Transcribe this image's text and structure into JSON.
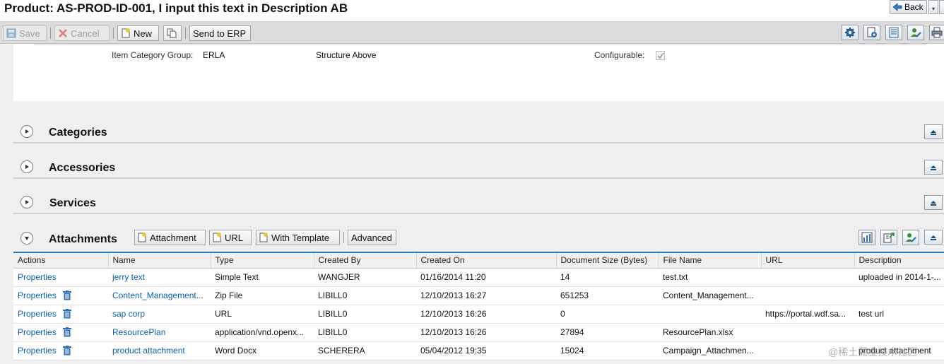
{
  "header": {
    "title": "Product: AS-PROD-ID-001, I input this text in Description AB",
    "back_label": "Back"
  },
  "toolbar": {
    "save_label": "Save",
    "cancel_label": "Cancel",
    "new_label": "New",
    "send_label": "Send to ERP"
  },
  "general": {
    "item_category_group_label": "Item Category Group:",
    "item_category_group_value": "ERLA",
    "structure_label": "Structure Above",
    "configurable_label": "Configurable:"
  },
  "sections": {
    "categories": "Categories",
    "accessories": "Accessories",
    "services": "Services",
    "attachments": "Attachments"
  },
  "attachments_toolbar": {
    "attachment_label": "Attachment",
    "url_label": "URL",
    "with_template_label": "With Template",
    "advanced_label": "Advanced"
  },
  "table": {
    "columns": [
      "Actions",
      "Name",
      "Type",
      "Created By",
      "Created On",
      "Document Size (Bytes)",
      "File Name",
      "URL",
      "Description"
    ],
    "rows": [
      {
        "action": "Properties",
        "name": "jerry text",
        "type": "Simple Text",
        "created_by": "WANGJER",
        "created_on": "01/16/2014 11:20",
        "size": "14",
        "file_name": "test.txt",
        "url": "",
        "description": "uploaded in 2014-1-..."
      },
      {
        "action": "Properties",
        "name": "Content_Management...",
        "type": "Zip File",
        "created_by": "LIBILL0",
        "created_on": "12/10/2013 16:27",
        "size": "651253",
        "file_name": "Content_Management...",
        "url": "",
        "description": ""
      },
      {
        "action": "Properties",
        "name": "sap corp",
        "type": "URL",
        "created_by": "LIBILL0",
        "created_on": "12/10/2013 16:26",
        "size": "0",
        "file_name": "",
        "url": "https://portal.wdf.sa...",
        "description": "test url"
      },
      {
        "action": "Properties",
        "name": "ResourcePlan",
        "type": "application/vnd.openx...",
        "created_by": "LIBILL0",
        "created_on": "12/10/2013 16:26",
        "size": "27894",
        "file_name": "ResourcePlan.xlsx",
        "url": "",
        "description": ""
      },
      {
        "action": "Properties",
        "name": "product attachment",
        "type": "Word Docx",
        "created_by": "SCHERERA",
        "created_on": "05/04/2012 19:35",
        "size": "15024",
        "file_name": "Campaign_Attachmen...",
        "url": "",
        "description": "product attachment"
      }
    ]
  },
  "watermark": "@稀土掘金技术社区",
  "colors": {
    "link": "#0b5faa",
    "table_accent": "#2b7ec0",
    "toolbar_bg": "#dcdcdc",
    "section_bg": "#efefef"
  }
}
